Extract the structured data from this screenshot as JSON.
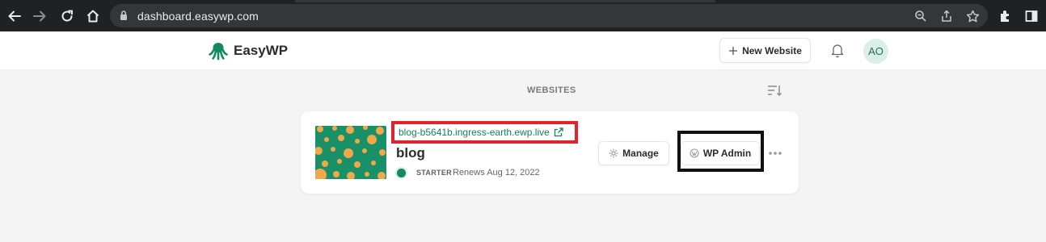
{
  "browser": {
    "url": "dashboard.easywp.com",
    "icons": [
      "back-arrow-icon",
      "forward-arrow-icon",
      "reload-icon",
      "home-icon",
      "lock-icon",
      "zoom-icon",
      "share-icon",
      "bookmark-star-icon",
      "extensions-icon",
      "side-panel-icon"
    ]
  },
  "header": {
    "brand": "EasyWP",
    "new_website_label": "New Website",
    "avatar_initials": "AO",
    "brand_color": "#128a5d"
  },
  "main": {
    "section_title": "WEBSITES",
    "sites": [
      {
        "url": "blog-b5641b.ingress-earth.ewp.live",
        "name": "blog",
        "plan": "STARTER",
        "renews": "Renews Aug 12, 2022",
        "status_color": "#128a5d",
        "manage_label": "Manage",
        "wp_admin_label": "WP Admin"
      }
    ]
  },
  "annotations": {
    "url_highlight_color": "#e0242f",
    "wp_admin_highlight_color": "#111111"
  }
}
